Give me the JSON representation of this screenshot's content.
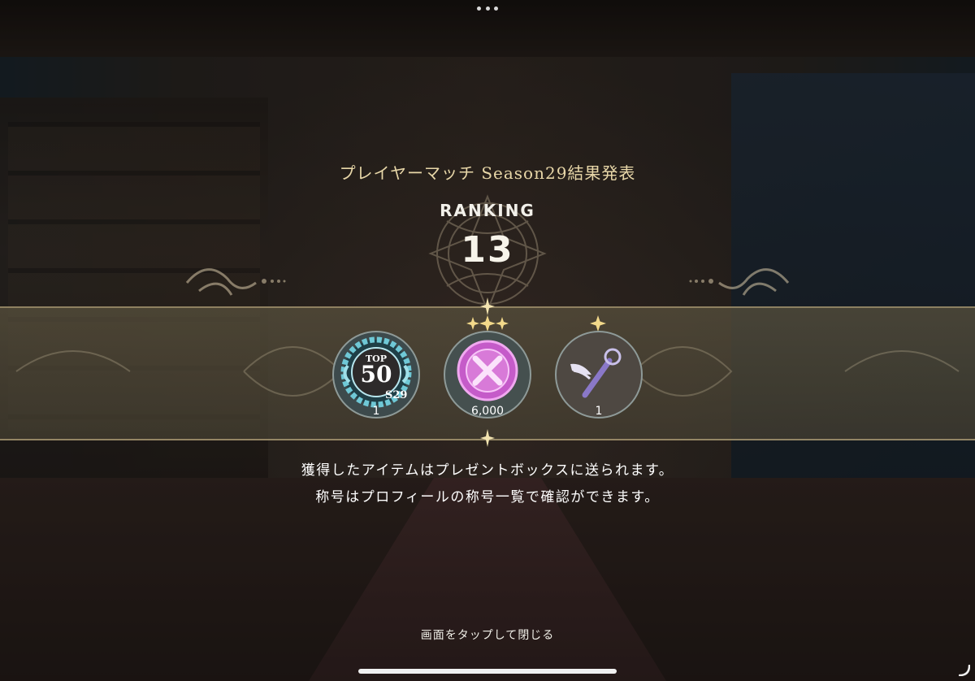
{
  "header": {
    "title": "プレイヤーマッチ Season29結果発表",
    "ranking_label": "RANKING",
    "ranking_value": "13"
  },
  "rewards": [
    {
      "icon": "top-50-badge-icon",
      "badge_top": "TOP",
      "badge_number": "50",
      "badge_season": "S29",
      "count": "1",
      "stars": 0
    },
    {
      "icon": "pink-crystal-orb-icon",
      "count": "6,000",
      "stars": 3
    },
    {
      "icon": "winged-magic-wand-icon",
      "count": "1",
      "stars": 1
    }
  ],
  "messages": {
    "line1": "獲得したアイテムはプレゼントボックスに送られます。",
    "line2": "称号はプロフィールの称号一覧で確認ができます。"
  },
  "footer": {
    "tap_to_close": "画面をタップして閉じる"
  },
  "colors": {
    "title_gold": "#e8d7a8",
    "band": "#5a523e",
    "band_border": "#d2be8c",
    "badge_teal": "#6fc8d6",
    "orb_pink": "#d46ad6",
    "wand_purple": "#8a78c8"
  }
}
